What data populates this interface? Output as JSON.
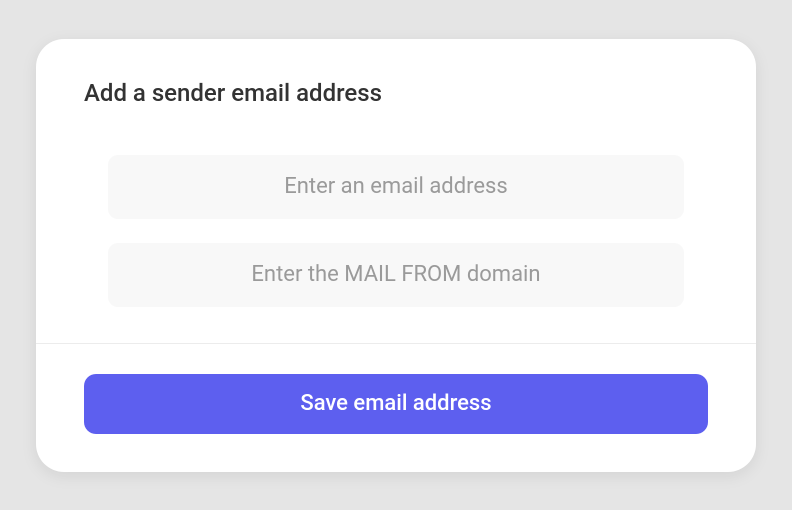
{
  "modal": {
    "title": "Add a sender email address",
    "fields": {
      "email": {
        "value": "",
        "placeholder": "Enter an email address"
      },
      "mailFromDomain": {
        "value": "",
        "placeholder": "Enter the MAIL FROM domain"
      }
    },
    "actions": {
      "save_label": "Save email address"
    }
  }
}
